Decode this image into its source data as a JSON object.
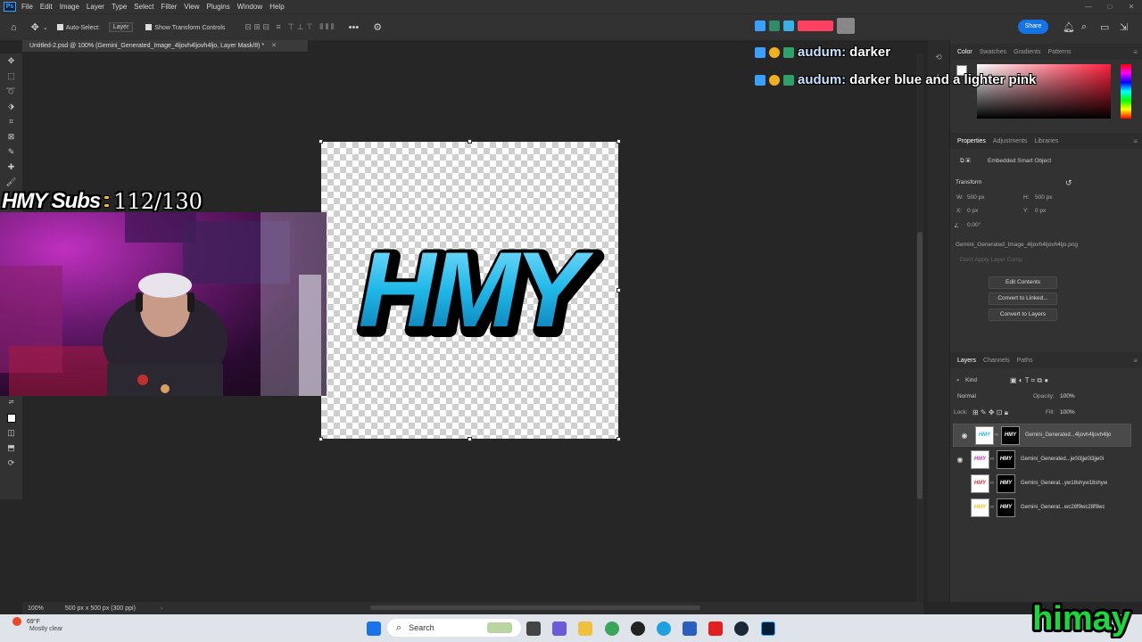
{
  "menubar": {
    "logo": "Ps",
    "items": [
      "File",
      "Edit",
      "Image",
      "Layer",
      "Type",
      "Select",
      "Filter",
      "View",
      "Plugins",
      "Window",
      "Help"
    ]
  },
  "options": {
    "auto_select_label": "Auto-Select:",
    "layer_select": "Layer",
    "transform_controls_label": "Show Transform Controls",
    "share_label": "Share"
  },
  "document": {
    "tab_title": "Untitled-2.psd @ 100% (Gemini_Generated_Image_4ljovh4ljovh4ljo, Layer Mask/8) *",
    "zoom": "100%",
    "doc_info": "500 px x 500 px (300 ppi)",
    "artwork_text": "HMY"
  },
  "panels": {
    "color_tabs": [
      "Color",
      "Swatches",
      "Gradients",
      "Patterns"
    ],
    "props_tabs": [
      "Properties",
      "Adjustments",
      "Libraries"
    ],
    "smart_object_label": "Embedded Smart Object",
    "transform_label": "Transform",
    "w_label": "W:",
    "w_value": "500 px",
    "h_label": "H:",
    "h_value": "500 px",
    "x_label": "X:",
    "x_value": "0 px",
    "y_label": "Y:",
    "y_value": "0 px",
    "angle_value": "0.00°",
    "filename": "Gemini_Generated_Image_4ljovh4ljovh4ljo.png",
    "layer_comp": "Don't Apply Layer Comp",
    "btn_edit": "Edit Contents",
    "btn_linked": "Convert to Linked...",
    "btn_layers": "Convert to Layers",
    "layers_tabs": [
      "Layers",
      "Channels",
      "Paths"
    ],
    "kind_label": "Kind",
    "blend_mode": "Normal",
    "opacity_label": "Opacity:",
    "opacity_value": "100%",
    "lock_label": "Lock:",
    "fill_label": "Fill:",
    "fill_value": "100%",
    "layers": [
      {
        "name": "Gemini_Generated...4ljovh4ljovh4ljo",
        "visible": true,
        "color": "#2fb6e8"
      },
      {
        "name": "Gemini_Generated...je0i3jje0i3jje0i",
        "visible": true,
        "color": "#c73ab0"
      },
      {
        "name": "Gemini_Generat...yw18shyw18shyw",
        "visible": false,
        "color": "#d33a3a"
      },
      {
        "name": "Gemini_Generat...wc28f9wc28f9wc",
        "visible": false,
        "color": "#e8c62f"
      }
    ]
  },
  "overlay": {
    "subs_label": "HMY Subs",
    "subs_value": "112/130",
    "chat": [
      {
        "user": "audum:",
        "message": "darker"
      },
      {
        "user": "audum:",
        "message": "darker blue and a lighter pink"
      }
    ],
    "watermark": "himay"
  },
  "taskbar": {
    "temperature": "69°F",
    "weather": "Mostly clear",
    "search_placeholder": "Search"
  }
}
